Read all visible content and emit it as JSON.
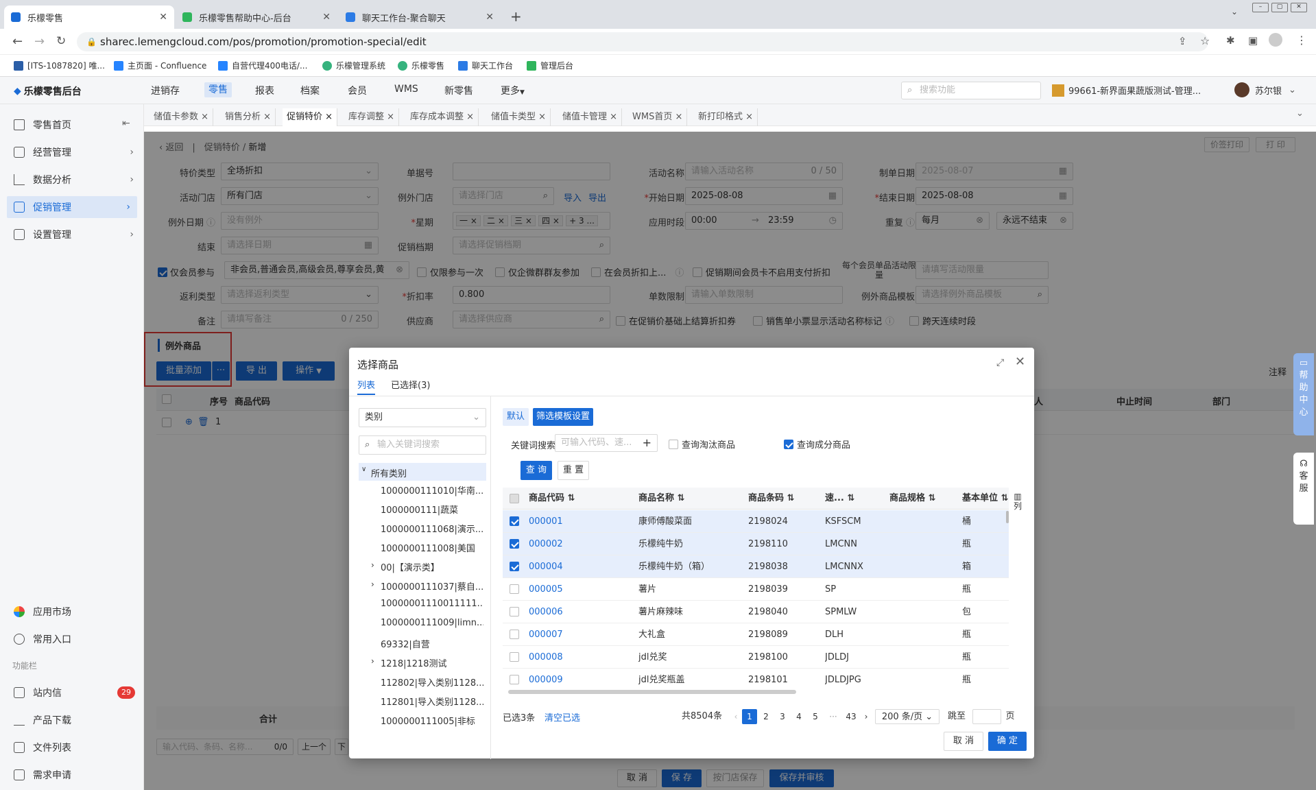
{
  "browser": {
    "tabs": [
      {
        "label": "乐檬零售"
      },
      {
        "label": "乐檬零售帮助中心-后台"
      },
      {
        "label": "聊天工作台-聚合聊天"
      }
    ],
    "url": "sharec.lemengcloud.com/pos/promotion/promotion-special/edit"
  },
  "bookmarks": [
    "[ITS-1087820] 唯...",
    "主页面 - Confluence",
    "自营代理400电话/...",
    "乐檬管理系统",
    "乐檬零售",
    "聊天工作台",
    "管理后台"
  ],
  "app": {
    "brand": "乐檬零售后台",
    "nav": [
      "进销存",
      "零售",
      "报表",
      "档案",
      "会员",
      "WMS",
      "新零售",
      "更多"
    ],
    "search_placeholder": "搜索功能",
    "store": "99661-新界面果蔬版测试-管理...",
    "user": "苏尔银"
  },
  "sidebar": {
    "items": [
      "零售首页",
      "经营管理",
      "数据分析",
      "促销管理",
      "设置管理"
    ],
    "bottom": [
      "应用市场",
      "常用入口"
    ],
    "section": "功能栏",
    "tools": [
      "站内信",
      "产品下载",
      "文件列表",
      "需求申请"
    ],
    "badge": "29"
  },
  "page_tabs": [
    "储值卡参数",
    "销售分析",
    "促销特价",
    "库存调整",
    "库存成本调整",
    "储值卡类型",
    "储值卡管理",
    "WMS首页",
    "新打印格式"
  ],
  "breadcrumb": {
    "back": "返回",
    "parent": "促销特价",
    "current": "新增"
  },
  "top_buttons": {
    "price_print": "价签打印",
    "print": "打 印"
  },
  "form": {
    "type_label": "特价类型",
    "type_value": "全场折扣",
    "doc_label": "单据号",
    "act_label": "活动名称",
    "act_ph": "请输入活动名称",
    "act_count": "0 / 50",
    "made_label": "制单日期",
    "made_value": "2025-08-07",
    "store_label": "活动门店",
    "store_value": "所有门店",
    "ex_store_label": "例外门店",
    "ex_store_ph": "请选择门店",
    "import": "导入",
    "export": "导出",
    "start_label": "开始日期",
    "start_value": "2025-08-08",
    "end_label": "结束日期",
    "end_value": "2025-08-08",
    "ex_date_label": "例外日期",
    "ex_date_ph": "没有例外",
    "week_label": "星期",
    "weeks": [
      "一",
      "二",
      "三",
      "四",
      "+ 3 ..."
    ],
    "period_label": "应用时段",
    "period_from": "00:00",
    "period_to": "23:59",
    "repeat_label": "重复",
    "repeat_value": "每月",
    "forever": "永远不结束",
    "end2_label": "结束",
    "end2_ph": "请选择日期",
    "grade_label": "促销档期",
    "grade_ph": "请选择促销档期",
    "member_label": "仅会员参与",
    "member_value": "非会员,普通会员,高级会员,尊享会员,黄",
    "once": "仅限参与一次",
    "wechat": "仅企微群群友参加",
    "card_disc": "在会员折扣上...",
    "no_pay_disc": "促销期间会员卡不启用支付折扣",
    "limit_label": "每个会员单品活动限量",
    "limit_ph": "请填写活动限量",
    "rebate_label": "返利类型",
    "rebate_ph": "请选择返利类型",
    "rate_label": "折扣率",
    "rate_value": "0.800",
    "single_label": "单数限制",
    "single_ph": "请输入单数限制",
    "ex_tpl_label": "例外商品模板",
    "ex_tpl_ph": "请选择例外商品模板",
    "remark_label": "备注",
    "remark_ph": "请填写备注",
    "remark_count": "0 / 250",
    "supplier_label": "供应商",
    "supplier_ph": "请选择供应商",
    "coupon": "在促销价基础上结算折扣券",
    "receipt": "销售单小票显示活动名称标记",
    "cross": "跨天连续时段"
  },
  "section": {
    "title": "例外商品",
    "batch_add": "批量添加",
    "more": "···",
    "export": "导 出",
    "ops": "操作",
    "note": "注释",
    "cols": [
      "序号",
      "商品代码"
    ],
    "row_no": "1",
    "right_cols": [
      "人",
      "中止时间",
      "部门"
    ],
    "total": "合计",
    "search_ph": "输入代码、条码、名称...",
    "search_count": "0/0",
    "prev": "上一个",
    "next": "下"
  },
  "footer": {
    "cancel": "取 消",
    "save": "保 存",
    "store_save": "按门店保存",
    "save_audit": "保存并审核"
  },
  "float": {
    "help": "帮助中心",
    "service": "客服"
  },
  "modal": {
    "title": "选择商品",
    "tabs": [
      "列表",
      "已选择(3)"
    ],
    "category": "类别",
    "kw_ph": "输入关键词搜索",
    "root": "所有类别",
    "tree": [
      "1000000111010|华南...",
      "1000000111|蔬菜",
      "1000000111068|演示...",
      "1000000111008|美国",
      "00|【演示类】",
      "1000000111037|蔡自...",
      "10000001110011111...",
      "1000000111009|limn...",
      "69332|自营",
      "1218|1218测试",
      "112802|导入类别1128...",
      "112801|导入类别1128...",
      "1000000111005|非标"
    ],
    "default_btn": "默认",
    "filter_btn": "筛选模板设置",
    "kw_label": "关键词搜索",
    "kw_input_ph": "可输入代码、速...",
    "obsolete": "查询淘汰商品",
    "finished": "查询成分商品",
    "query": "查 询",
    "reset": "重 置",
    "columns": [
      "商品代码",
      "商品名称",
      "商品条码",
      "速...",
      "商品规格",
      "基本单位"
    ],
    "col_btn": "列",
    "rows": [
      {
        "code": "000001",
        "name": "康师傅酸菜面",
        "barcode": "2198024",
        "pinyin": "KSFSCM",
        "spec": "",
        "unit": "桶",
        "checked": true
      },
      {
        "code": "000002",
        "name": "乐檬纯牛奶",
        "barcode": "2198110",
        "pinyin": "LMCNN",
        "spec": "",
        "unit": "瓶",
        "checked": true
      },
      {
        "code": "000004",
        "name": "乐檬纯牛奶（箱）",
        "barcode": "2198038",
        "pinyin": "LMCNNX",
        "spec": "",
        "unit": "箱",
        "checked": true
      },
      {
        "code": "000005",
        "name": "薯片",
        "barcode": "2198039",
        "pinyin": "SP",
        "spec": "",
        "unit": "瓶",
        "checked": false
      },
      {
        "code": "000006",
        "name": "薯片麻辣味",
        "barcode": "2198040",
        "pinyin": "SPMLW",
        "spec": "",
        "unit": "包",
        "checked": false
      },
      {
        "code": "000007",
        "name": "大礼盒",
        "barcode": "2198089",
        "pinyin": "DLH",
        "spec": "",
        "unit": "瓶",
        "checked": false
      },
      {
        "code": "000008",
        "name": "jdl兑奖",
        "barcode": "2198100",
        "pinyin": "JDLDJ",
        "spec": "",
        "unit": "瓶",
        "checked": false
      },
      {
        "code": "000009",
        "name": "jdl兑奖瓶盖",
        "barcode": "2198101",
        "pinyin": "JDLDJPG",
        "spec": "",
        "unit": "瓶",
        "checked": false
      }
    ],
    "selected": "已选3条",
    "clear": "清空已选",
    "total": "共8504条",
    "pages": [
      "1",
      "2",
      "3",
      "4",
      "5",
      "···",
      "43"
    ],
    "page_size": "200 条/页",
    "jump": "跳至",
    "page_unit": "页",
    "cancel": "取 消",
    "ok": "确 定"
  }
}
